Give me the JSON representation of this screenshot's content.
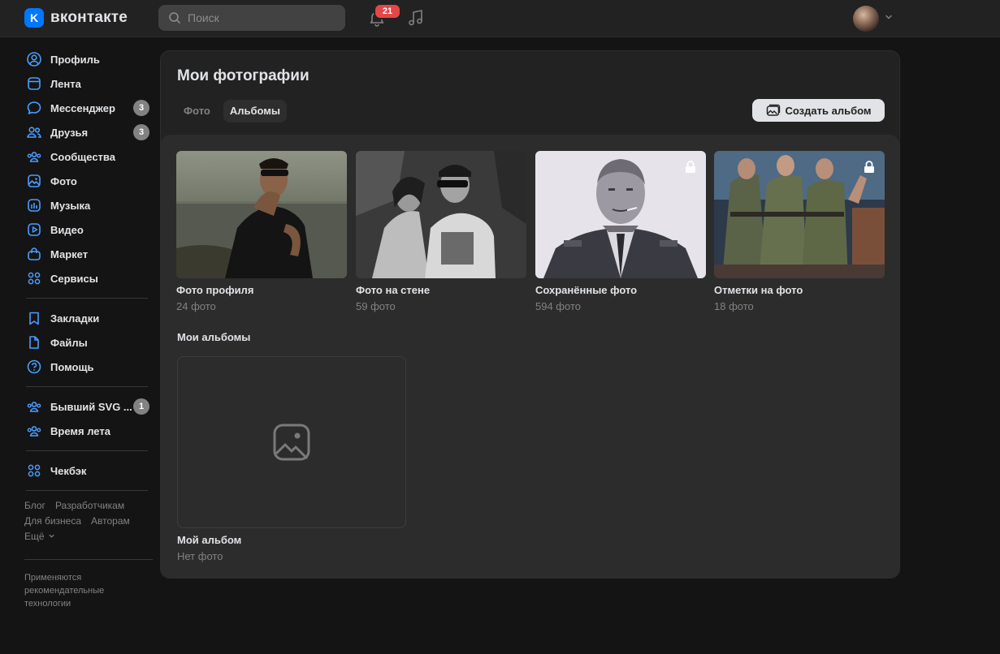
{
  "header": {
    "logo_mark": "K",
    "logo_text": "вконтакте",
    "search_placeholder": "Поиск",
    "notifications_count": "21"
  },
  "sidebar": {
    "items": [
      {
        "label": "Профиль",
        "icon": "profile-icon"
      },
      {
        "label": "Лента",
        "icon": "feed-icon"
      },
      {
        "label": "Мессенджер",
        "icon": "messenger-icon",
        "count": "3"
      },
      {
        "label": "Друзья",
        "icon": "friends-icon",
        "count": "3"
      },
      {
        "label": "Сообщества",
        "icon": "communities-icon"
      },
      {
        "label": "Фото",
        "icon": "photo-icon"
      },
      {
        "label": "Музыка",
        "icon": "music-icon"
      },
      {
        "label": "Видео",
        "icon": "video-icon"
      },
      {
        "label": "Маркет",
        "icon": "market-icon"
      },
      {
        "label": "Сервисы",
        "icon": "services-icon"
      }
    ],
    "items2": [
      {
        "label": "Закладки",
        "icon": "bookmark-icon"
      },
      {
        "label": "Файлы",
        "icon": "file-icon"
      },
      {
        "label": "Помощь",
        "icon": "help-icon"
      }
    ],
    "items3": [
      {
        "label": "Бывший SVG ...",
        "icon": "community-icon",
        "count": "1"
      },
      {
        "label": "Время лета",
        "icon": "community-icon"
      }
    ],
    "items4": [
      {
        "label": "Чекбэк",
        "icon": "apps-icon"
      }
    ],
    "footer": {
      "blog": "Блог",
      "developers": "Разработчикам",
      "business": "Для бизнеса",
      "authors": "Авторам",
      "more": "Ещё"
    },
    "recs": "Применяются рекомендательные технологии"
  },
  "main": {
    "title": "Мои фотографии",
    "tabs": [
      "Фото",
      "Альбомы"
    ],
    "create_album": "Создать альбом",
    "albums": [
      {
        "title": "Фото профиля",
        "count": "24 фото",
        "locked": false
      },
      {
        "title": "Фото на стене",
        "count": "59 фото",
        "locked": false
      },
      {
        "title": "Сохранённые фото",
        "count": "594 фото",
        "locked": true
      },
      {
        "title": "Отметки на фото",
        "count": "18 фото",
        "locked": true
      }
    ],
    "my_albums_title": "Мои альбомы",
    "my_album": {
      "title": "Мой альбом",
      "count": "Нет фото"
    }
  },
  "colors": {
    "accent": "#0077ff",
    "background": "#141414",
    "card": "#222222",
    "badge_red": "#e64646"
  }
}
